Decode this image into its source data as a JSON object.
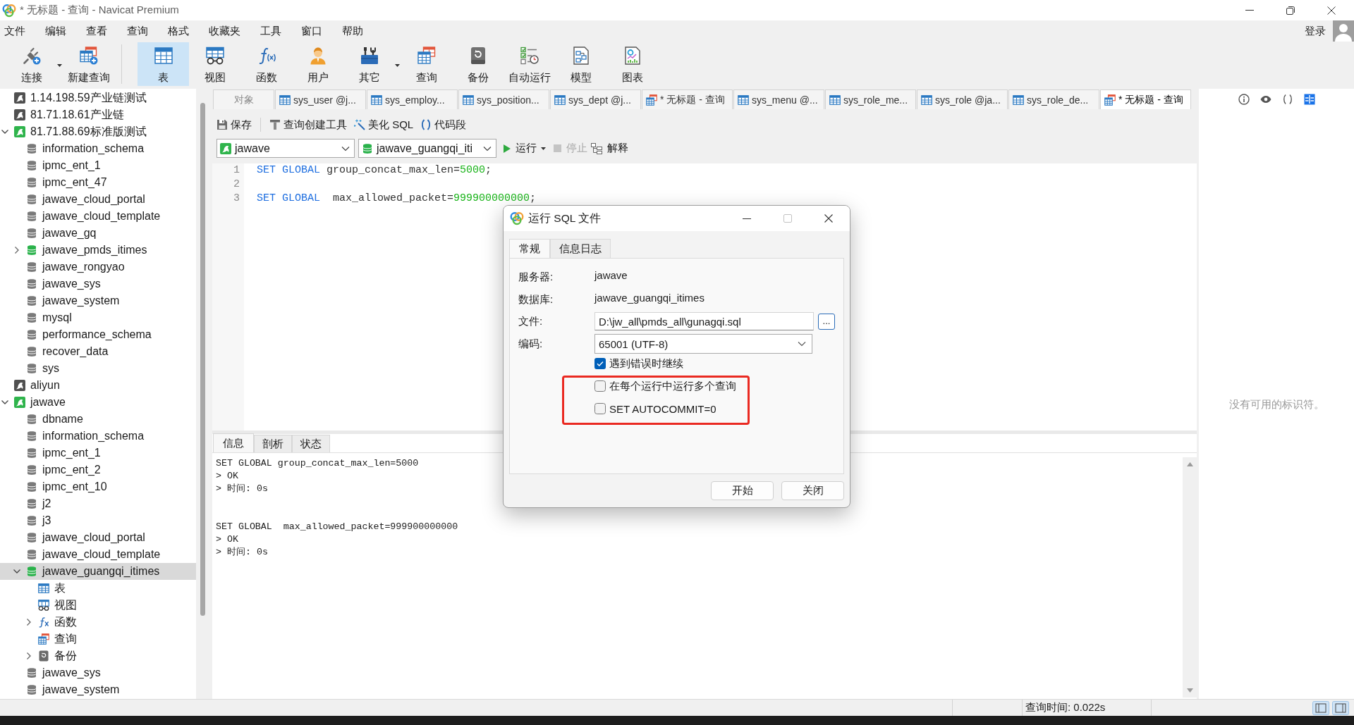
{
  "window": {
    "title": "* 无标题 - 查询 - Navicat Premium"
  },
  "menu": [
    "文件",
    "编辑",
    "查看",
    "查询",
    "格式",
    "收藏夹",
    "工具",
    "窗口",
    "帮助"
  ],
  "account": {
    "label": "登录"
  },
  "toolbar": [
    [
      {
        "label": "连接",
        "kind": "connect",
        "dropdown": true,
        "selected": false
      },
      {
        "label": "新建查询",
        "kind": "new-query",
        "dropdown": false,
        "selected": false
      }
    ],
    [
      {
        "label": "表",
        "kind": "table",
        "dropdown": false,
        "selected": true
      },
      {
        "label": "视图",
        "kind": "view",
        "dropdown": false,
        "selected": false
      },
      {
        "label": "函数",
        "kind": "function",
        "dropdown": false,
        "selected": false
      },
      {
        "label": "用户",
        "kind": "user",
        "dropdown": false,
        "selected": false
      },
      {
        "label": "其它",
        "kind": "other",
        "dropdown": true,
        "selected": false
      },
      {
        "label": "查询",
        "kind": "query",
        "dropdown": false,
        "selected": false
      },
      {
        "label": "备份",
        "kind": "backup",
        "dropdown": false,
        "selected": false
      },
      {
        "label": "自动运行",
        "kind": "automation",
        "dropdown": false,
        "selected": false
      },
      {
        "label": "模型",
        "kind": "model",
        "dropdown": false,
        "selected": false
      },
      {
        "label": "图表",
        "kind": "chart",
        "dropdown": false,
        "selected": false
      }
    ]
  ],
  "navigator": {
    "items": [
      {
        "label": "1.14.198.59产业链测试",
        "kind": "connection",
        "open": false,
        "selected": false
      },
      {
        "label": "81.71.18.61产业链",
        "kind": "connection",
        "open": false,
        "selected": false
      },
      {
        "label": "81.71.88.69标准版测试",
        "kind": "connection",
        "open": true,
        "selected": false,
        "expanded": true,
        "children": [
          {
            "label": "information_schema",
            "kind": "database",
            "open": false,
            "selected": false
          },
          {
            "label": "ipmc_ent_1",
            "kind": "database",
            "open": false,
            "selected": false
          },
          {
            "label": "ipmc_ent_47",
            "kind": "database",
            "open": false,
            "selected": false
          },
          {
            "label": "jawave_cloud_portal",
            "kind": "database",
            "open": false,
            "selected": false
          },
          {
            "label": "jawave_cloud_template",
            "kind": "database",
            "open": false,
            "selected": false
          },
          {
            "label": "jawave_gq",
            "kind": "database",
            "open": false,
            "selected": false
          },
          {
            "label": "jawave_pmds_itimes",
            "kind": "database",
            "open": true,
            "selected": false,
            "expanded": false
          },
          {
            "label": "jawave_rongyao",
            "kind": "database",
            "open": false,
            "selected": false
          },
          {
            "label": "jawave_sys",
            "kind": "database",
            "open": false,
            "selected": false
          },
          {
            "label": "jawave_system",
            "kind": "database",
            "open": false,
            "selected": false
          },
          {
            "label": "mysql",
            "kind": "database",
            "open": false,
            "selected": false
          },
          {
            "label": "performance_schema",
            "kind": "database",
            "open": false,
            "selected": false
          },
          {
            "label": "recover_data",
            "kind": "database",
            "open": false,
            "selected": false
          },
          {
            "label": "sys",
            "kind": "database",
            "open": false,
            "selected": false
          }
        ]
      },
      {
        "label": "aliyun",
        "kind": "connection",
        "open": false,
        "selected": false
      },
      {
        "label": "jawave",
        "kind": "connection",
        "open": true,
        "selected": false,
        "expanded": true,
        "children": [
          {
            "label": "dbname",
            "kind": "database",
            "open": false,
            "selected": false
          },
          {
            "label": "information_schema",
            "kind": "database",
            "open": false,
            "selected": false
          },
          {
            "label": "ipmc_ent_1",
            "kind": "database",
            "open": false,
            "selected": false
          },
          {
            "label": "ipmc_ent_2",
            "kind": "database",
            "open": false,
            "selected": false
          },
          {
            "label": "ipmc_ent_10",
            "kind": "database",
            "open": false,
            "selected": false
          },
          {
            "label": "j2",
            "kind": "database",
            "open": false,
            "selected": false
          },
          {
            "label": "j3",
            "kind": "database",
            "open": false,
            "selected": false
          },
          {
            "label": "jawave_cloud_portal",
            "kind": "database",
            "open": false,
            "selected": false
          },
          {
            "label": "jawave_cloud_template",
            "kind": "database",
            "open": false,
            "selected": false
          },
          {
            "label": "jawave_guangqi_itimes",
            "kind": "database",
            "open": true,
            "selected": true,
            "expanded": true,
            "children": [
              {
                "label": "表",
                "kind": "tables",
                "selected": false
              },
              {
                "label": "视图",
                "kind": "views",
                "selected": false
              },
              {
                "label": "函数",
                "kind": "functions",
                "selected": false,
                "expanded": false
              },
              {
                "label": "查询",
                "kind": "queries",
                "selected": false
              },
              {
                "label": "备份",
                "kind": "backups",
                "selected": false,
                "expanded": false
              }
            ]
          },
          {
            "label": "jawave_sys",
            "kind": "database",
            "open": false,
            "selected": false
          },
          {
            "label": "jawave_system",
            "kind": "database",
            "open": false,
            "selected": false
          }
        ]
      }
    ]
  },
  "editor": {
    "tabs": [
      {
        "label": "对象",
        "kind": "objects",
        "selected": false
      },
      {
        "label": "sys_user @j...",
        "kind": "table",
        "selected": false
      },
      {
        "label": "sys_employ...",
        "kind": "table",
        "selected": false
      },
      {
        "label": "sys_position...",
        "kind": "table",
        "selected": false
      },
      {
        "label": "sys_dept @j...",
        "kind": "table",
        "selected": false
      },
      {
        "label": "* 无标题 - 查询",
        "kind": "query",
        "selected": false
      },
      {
        "label": "sys_menu @...",
        "kind": "table",
        "selected": false
      },
      {
        "label": "sys_role_me...",
        "kind": "table",
        "selected": false
      },
      {
        "label": "sys_role @ja...",
        "kind": "table",
        "selected": false
      },
      {
        "label": "sys_role_de...",
        "kind": "table",
        "selected": false
      },
      {
        "label": "* 无标题 - 查询",
        "kind": "query",
        "selected": true
      }
    ],
    "actions": [
      {
        "label": "保存",
        "kind": "save"
      },
      {
        "label": "查询创建工具",
        "kind": "builder"
      },
      {
        "label": "美化 SQL",
        "kind": "beautify"
      },
      {
        "label": "代码段",
        "kind": "snippet"
      }
    ],
    "connection": {
      "value": "jawave"
    },
    "database": {
      "value": "jawave_guangqi_iti"
    },
    "run": [
      {
        "label": "运行",
        "kind": "run",
        "disabled": false,
        "dropdown": true
      },
      {
        "label": "停止",
        "kind": "stop",
        "disabled": true,
        "dropdown": false
      },
      {
        "label": "解释",
        "kind": "explain",
        "disabled": false,
        "dropdown": false
      }
    ],
    "lines": [
      {
        "number": "1",
        "tokens": [
          {
            "text": "SET GLOBAL",
            "kind": "keyword"
          },
          {
            "text": " group_concat_max_len=",
            "kind": "plain"
          },
          {
            "text": "5000",
            "kind": "number"
          },
          {
            "text": ";",
            "kind": "plain"
          }
        ]
      },
      {
        "number": "2"
      },
      {
        "number": "3",
        "tokens": [
          {
            "text": "SET GLOBAL",
            "kind": "keyword"
          },
          {
            "text": "  max_allowed_packet=",
            "kind": "plain"
          },
          {
            "text": "999900000000",
            "kind": "number"
          },
          {
            "text": ";",
            "kind": "plain"
          }
        ]
      }
    ]
  },
  "output": {
    "tabs": [
      {
        "label": "信息",
        "selected": true
      },
      {
        "label": "剖析",
        "selected": false
      },
      {
        "label": "状态",
        "selected": false
      }
    ],
    "messages": [
      {
        "lines": [
          "SET GLOBAL group_concat_max_len=5000",
          "> OK",
          "> 时间: 0s"
        ]
      },
      {
        "lines": [
          "SET GLOBAL  max_allowed_packet=999900000000",
          "> OK",
          "> 时间: 0s"
        ]
      }
    ]
  },
  "inspector": {
    "tools": [
      {
        "kind": "info",
        "selected": false
      },
      {
        "kind": "preview",
        "selected": false
      },
      {
        "kind": "code",
        "selected": false
      },
      {
        "kind": "layout",
        "selected": true
      }
    ],
    "empty_text": "没有可用的标识符。"
  },
  "status_bar": {
    "query_time": "查询时间: 0.022s"
  },
  "dialog": {
    "title": "运行 SQL 文件",
    "tabs": [
      {
        "label": "常规",
        "selected": true
      },
      {
        "label": "信息日志",
        "selected": false
      }
    ],
    "fields": [
      {
        "label": "服务器:",
        "kind": "text",
        "value": "jawave"
      },
      {
        "label": "数据库:",
        "kind": "text",
        "value": "jawave_guangqi_itimes"
      },
      {
        "label": "文件:",
        "kind": "file",
        "value": "D:\\jw_all\\pmds_all\\gunagqi.sql",
        "button": "..."
      },
      {
        "label": "编码:",
        "kind": "select",
        "value": "65001 (UTF-8)"
      }
    ],
    "options": [
      {
        "label": "遇到错误时继续",
        "checked": true,
        "highlighted": false
      },
      {
        "label": "在每个运行中运行多个查询",
        "checked": false,
        "highlighted": true
      },
      {
        "label": "SET AUTOCOMMIT=0",
        "checked": false,
        "highlighted": true
      }
    ],
    "buttons": [
      "开始",
      "关闭"
    ]
  }
}
